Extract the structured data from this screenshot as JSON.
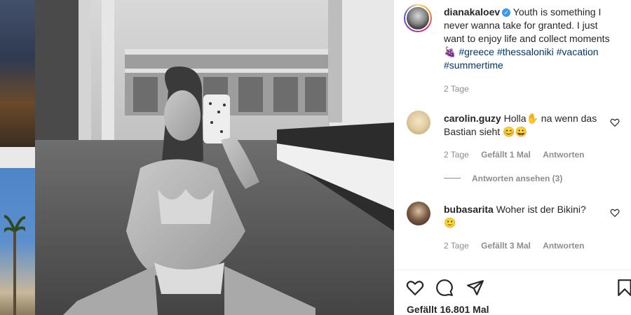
{
  "post": {
    "author": {
      "username": "dianakaloev",
      "verified": true,
      "caption_text": "Youth is something I never wanna take for granted. I just want to enjoy life and collect moments",
      "emoji": "🍇",
      "hashtags": [
        "#greece",
        "#thessaloniki",
        "#vacation",
        "#summertime"
      ],
      "time": "2 Tage"
    },
    "comments": [
      {
        "username": "carolin.guzy",
        "text": "Holla✋ na wenn das Bastian sieht 😊😀",
        "time": "2 Tage",
        "likes": "Gefällt 1 Mal",
        "reply": "Antworten",
        "view_replies": "Antworten ansehen (3)"
      },
      {
        "username": "bubasarita",
        "text": "Woher ist der Bikini? 🙂",
        "time": "2 Tage",
        "likes": "Gefällt 3 Mal",
        "reply": "Antworten"
      }
    ],
    "likes_total": "Gefällt 16.801 Mal",
    "icons": {
      "like": "heart-icon",
      "comment": "comment-icon",
      "share": "share-icon",
      "save": "bookmark-icon"
    },
    "colors": {
      "hashtag": "#00376b",
      "meta": "#8e8e8e",
      "verified": "#3897f0"
    }
  }
}
